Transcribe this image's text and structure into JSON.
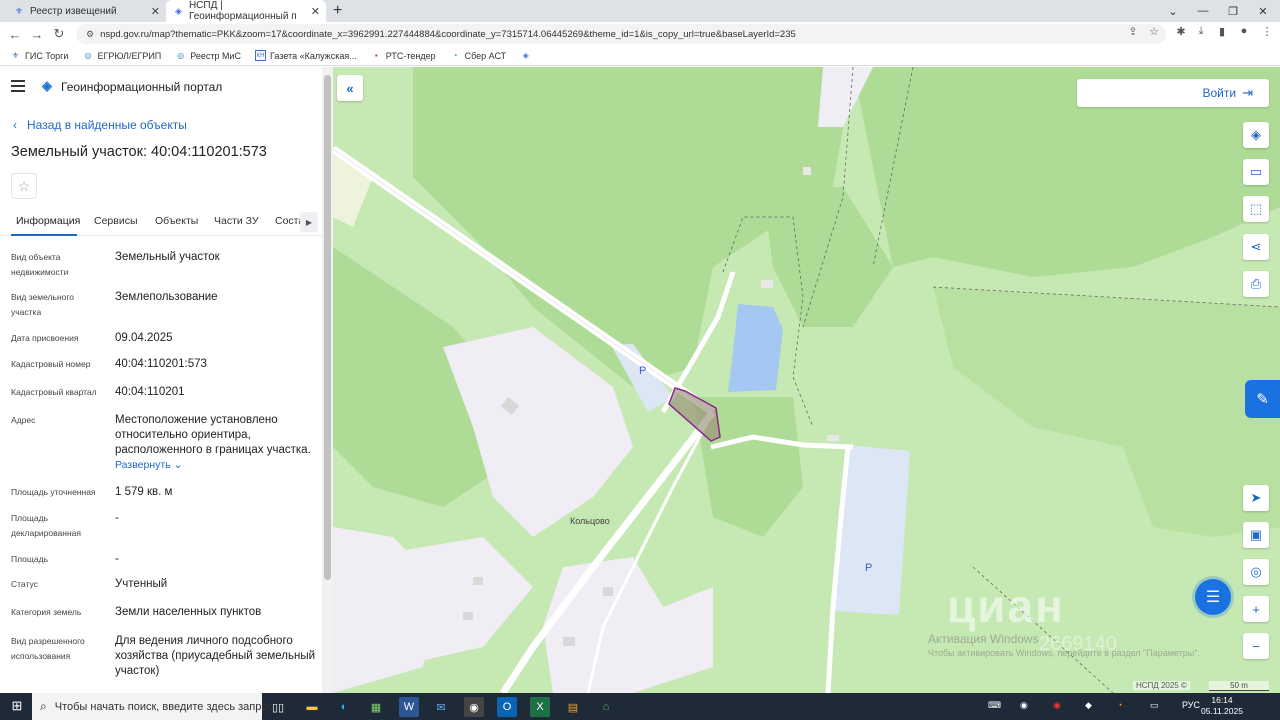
{
  "browser": {
    "tabs": [
      {
        "title": "Реестр извещений",
        "active": false
      },
      {
        "title": "НСПД | Геоинформационный п",
        "active": true
      }
    ],
    "url": "nspd.gov.ru/map?thematic=PKK&zoom=17&coordinate_x=3962991.227444884&coordinate_y=7315714.06445269&theme_id=1&is_copy_url=true&baseLayerId=235",
    "bookmarks": [
      {
        "label": "ГИС Торги",
        "icon": "gis-icon"
      },
      {
        "label": "ЕГРЮЛ/ЕГРИП",
        "icon": "egrul-icon"
      },
      {
        "label": "Реестр МиС",
        "icon": "registry-icon"
      },
      {
        "label": "Газета «Калужская...",
        "icon": "newspaper-icon"
      },
      {
        "label": "РТС-тендер",
        "icon": "rts-icon"
      },
      {
        "label": "Сбер АСТ",
        "icon": "sber-icon"
      }
    ]
  },
  "panel": {
    "portal_title": "Геоинформационный портал",
    "back_link": "Назад в найденные объекты",
    "object_title": "Земельный участок: 40:04:110201:573",
    "tabs": [
      "Информация",
      "Сервисы",
      "Объекты",
      "Части ЗУ",
      "Соста"
    ],
    "fields": [
      {
        "label": "Вид объекта недвижимости",
        "value": "Земельный участок"
      },
      {
        "label": "Вид земельного участка",
        "value": "Землепользование"
      },
      {
        "label": "Дата присвоения",
        "value": "09.04.2025"
      },
      {
        "label": "Кадастровый номер",
        "value": "40:04:110201:573"
      },
      {
        "label": "Кадастровый квартал",
        "value": "40:04:110201"
      },
      {
        "label": "Адрес",
        "value": "Местоположение установлено относительно ориентира, расположенного в границах участка."
      },
      {
        "label": "Площадь уточненная",
        "value": "1 579 кв. м"
      },
      {
        "label": "Площадь декларированная",
        "value": "-"
      },
      {
        "label": "Площадь",
        "value": "-"
      },
      {
        "label": "Статус",
        "value": "Учтенный"
      },
      {
        "label": "Категория земель",
        "value": "Земли населенных пунктов"
      },
      {
        "label": "Вид разрешенного использования",
        "value": "Для ведения личного подсобного хозяйства (приусадебный земельный участок)"
      }
    ],
    "expand_label": "Развернуть"
  },
  "map": {
    "login_label": "Войти",
    "place_label": "Кольцово",
    "parking_label": "P",
    "watermark_title": "Активация Windows",
    "watermark_text": "Чтобы активировать Windows, перейдите в раздел \"Параметры\".",
    "cian_text": "циан",
    "cian_number": "2669140",
    "copyright": "НСПД 2025 ©",
    "scale": "50 m",
    "colors": {
      "forest": "#c6e8b3",
      "meadow": "#aedb95",
      "water": "#a5c8f2",
      "parcel": "#8a2a8a"
    }
  },
  "taskbar": {
    "search_placeholder": "Чтобы начать поиск, введите здесь запрос",
    "lang": "РУС",
    "time": "16:14",
    "date": "05.11.2025"
  }
}
